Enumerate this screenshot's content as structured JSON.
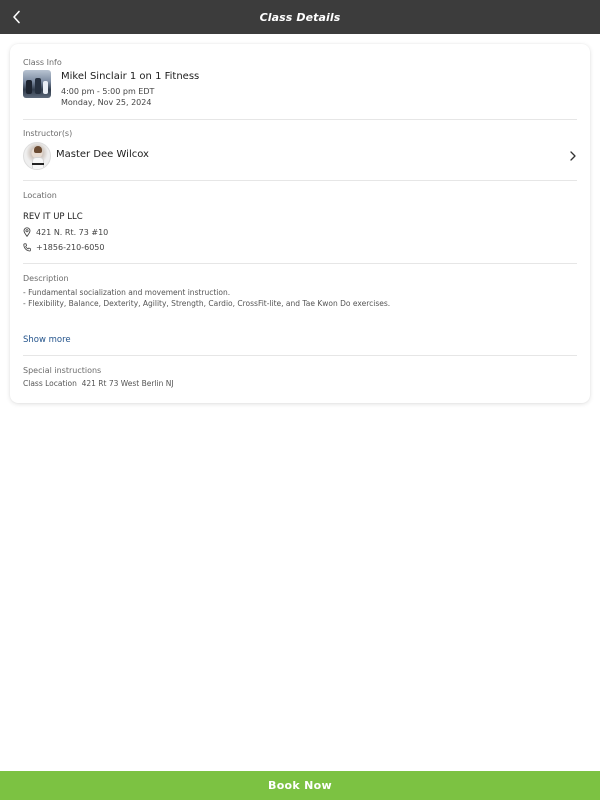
{
  "header": {
    "title": "Class Details",
    "back_icon": "chevron-left-icon"
  },
  "class_info": {
    "label": "Class Info",
    "name": "Mikel Sinclair 1 on 1 Fitness",
    "time": "4:00 pm - 5:00 pm EDT",
    "date": "Monday, Nov 25, 2024"
  },
  "instructor": {
    "label": "Instructor(s)",
    "name": "Master Dee Wilcox",
    "chevron_icon": "chevron-right-icon"
  },
  "location": {
    "label": "Location",
    "name": "REV IT UP LLC",
    "address": "421 N. Rt. 73 #10",
    "phone": "+1856-210-6050",
    "address_icon": "map-pin-icon",
    "phone_icon": "phone-icon"
  },
  "description": {
    "label": "Description",
    "line1": "- Fundamental socialization and movement instruction.",
    "line2": "- Flexibility, Balance, Dexterity, Agility, Strength, Cardio, CrossFit-lite, and Tae Kwon Do exercises.",
    "show_more": "Show more"
  },
  "special_instructions": {
    "label": "Special instructions",
    "value": "Class Location  421 Rt 73 West Berlin NJ"
  },
  "footer": {
    "book_label": "Book Now"
  },
  "colors": {
    "header_bg": "#3c3c3c",
    "book_button_bg": "#7cc242",
    "link": "#24548c"
  }
}
